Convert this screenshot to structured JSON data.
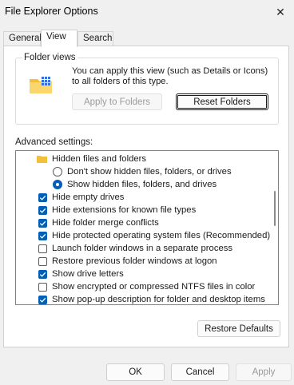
{
  "window": {
    "title": "File Explorer Options",
    "close_glyph": "✕"
  },
  "tabs": [
    {
      "label": "General"
    },
    {
      "label": "View"
    },
    {
      "label": "Search"
    }
  ],
  "folder_views": {
    "label": "Folder views",
    "description": "You can apply this view (such as Details or Icons) to all folders of this type.",
    "apply_button": "Apply to Folders",
    "reset_button": "Reset Folders"
  },
  "advanced": {
    "label": "Advanced settings:",
    "items": [
      {
        "kind": "folder",
        "label": "Hidden files and folders"
      },
      {
        "kind": "radio",
        "checked": false,
        "label": "Don't show hidden files, folders, or drives"
      },
      {
        "kind": "radio",
        "checked": true,
        "label": "Show hidden files, folders, and drives"
      },
      {
        "kind": "checkbox",
        "checked": true,
        "label": "Hide empty drives"
      },
      {
        "kind": "checkbox",
        "checked": true,
        "label": "Hide extensions for known file types"
      },
      {
        "kind": "checkbox",
        "checked": true,
        "label": "Hide folder merge conflicts"
      },
      {
        "kind": "checkbox",
        "checked": true,
        "label": "Hide protected operating system files (Recommended)"
      },
      {
        "kind": "checkbox",
        "checked": false,
        "label": "Launch folder windows in a separate process"
      },
      {
        "kind": "checkbox",
        "checked": false,
        "label": "Restore previous folder windows at logon"
      },
      {
        "kind": "checkbox",
        "checked": true,
        "label": "Show drive letters"
      },
      {
        "kind": "checkbox",
        "checked": false,
        "label": "Show encrypted or compressed NTFS files in color"
      },
      {
        "kind": "checkbox",
        "checked": true,
        "label": "Show pop-up description for folder and desktop items"
      }
    ]
  },
  "restore_defaults": "Restore Defaults",
  "footer": {
    "ok": "OK",
    "cancel": "Cancel",
    "apply": "Apply"
  },
  "colors": {
    "accent": "#005fb8",
    "folder": "#f3c03a"
  },
  "icons": {
    "close": "close-icon",
    "folder": "folder-icon",
    "checkbox": "checkmark-icon"
  }
}
